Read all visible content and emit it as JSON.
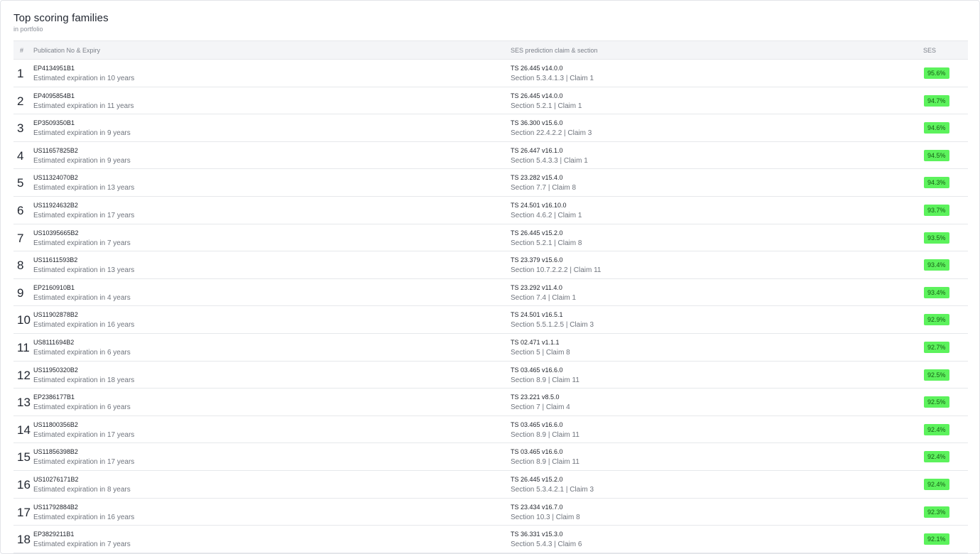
{
  "card": {
    "title": "Top scoring families",
    "subtitle": "in portfolio"
  },
  "table": {
    "headers": {
      "num": "#",
      "pub": "Publication No & Expiry",
      "claim": "SES prediction claim & section",
      "ses": "SES"
    },
    "rows": [
      {
        "num": "1",
        "pub": "EP4134951B1",
        "exp": "Estimated expiration in 10 years",
        "spec": "TS 26.445 v14.0.0",
        "sec": "Section 5.3.4.1.3 | Claim 1",
        "ses": "95.6%"
      },
      {
        "num": "2",
        "pub": "EP4095854B1",
        "exp": "Estimated expiration in 11 years",
        "spec": "TS 26.445 v14.0.0",
        "sec": "Section 5.2.1 | Claim 1",
        "ses": "94.7%"
      },
      {
        "num": "3",
        "pub": "EP3509350B1",
        "exp": "Estimated expiration in 9 years",
        "spec": "TS 36.300 v15.6.0",
        "sec": "Section 22.4.2.2 | Claim 3",
        "ses": "94.6%"
      },
      {
        "num": "4",
        "pub": "US11657825B2",
        "exp": "Estimated expiration in 9 years",
        "spec": "TS 26.447 v16.1.0",
        "sec": "Section 5.4.3.3 | Claim 1",
        "ses": "94.5%"
      },
      {
        "num": "5",
        "pub": "US11324070B2",
        "exp": "Estimated expiration in 13 years",
        "spec": "TS 23.282 v15.4.0",
        "sec": "Section 7.7 | Claim 8",
        "ses": "94.3%"
      },
      {
        "num": "6",
        "pub": "US11924632B2",
        "exp": "Estimated expiration in 17 years",
        "spec": "TS 24.501 v16.10.0",
        "sec": "Section 4.6.2 | Claim 1",
        "ses": "93.7%"
      },
      {
        "num": "7",
        "pub": "US10395665B2",
        "exp": "Estimated expiration in 7 years",
        "spec": "TS 26.445 v15.2.0",
        "sec": "Section 5.2.1 | Claim 8",
        "ses": "93.5%"
      },
      {
        "num": "8",
        "pub": "US11611593B2",
        "exp": "Estimated expiration in 13 years",
        "spec": "TS 23.379 v15.6.0",
        "sec": "Section 10.7.2.2.2 | Claim 11",
        "ses": "93.4%"
      },
      {
        "num": "9",
        "pub": "EP2160910B1",
        "exp": "Estimated expiration in 4 years",
        "spec": "TS 23.292 v11.4.0",
        "sec": "Section 7.4 | Claim 1",
        "ses": "93.4%"
      },
      {
        "num": "10",
        "pub": "US11902878B2",
        "exp": "Estimated expiration in 16 years",
        "spec": "TS 24.501 v16.5.1",
        "sec": "Section 5.5.1.2.5 | Claim 3",
        "ses": "92.9%"
      },
      {
        "num": "11",
        "pub": "US8111694B2",
        "exp": "Estimated expiration in 6 years",
        "spec": "TS 02.471 v1.1.1",
        "sec": "Section 5 | Claim 8",
        "ses": "92.7%"
      },
      {
        "num": "12",
        "pub": "US11950320B2",
        "exp": "Estimated expiration in 18 years",
        "spec": "TS 03.465 v16.6.0",
        "sec": "Section 8.9 | Claim 11",
        "ses": "92.5%"
      },
      {
        "num": "13",
        "pub": "EP2386177B1",
        "exp": "Estimated expiration in 6 years",
        "spec": "TS 23.221 v8.5.0",
        "sec": "Section 7 | Claim 4",
        "ses": "92.5%"
      },
      {
        "num": "14",
        "pub": "US11800356B2",
        "exp": "Estimated expiration in 17 years",
        "spec": "TS 03.465 v16.6.0",
        "sec": "Section 8.9 | Claim 11",
        "ses": "92.4%"
      },
      {
        "num": "15",
        "pub": "US11856398B2",
        "exp": "Estimated expiration in 17 years",
        "spec": "TS 03.465 v16.6.0",
        "sec": "Section 8.9 | Claim 11",
        "ses": "92.4%"
      },
      {
        "num": "16",
        "pub": "US10276171B2",
        "exp": "Estimated expiration in 8 years",
        "spec": "TS 26.445 v15.2.0",
        "sec": "Section 5.3.4.2.1 | Claim 3",
        "ses": "92.4%"
      },
      {
        "num": "17",
        "pub": "US11792884B2",
        "exp": "Estimated expiration in 16 years",
        "spec": "TS 23.434 v16.7.0",
        "sec": "Section 10.3 | Claim 8",
        "ses": "92.3%"
      },
      {
        "num": "18",
        "pub": "EP3829211B1",
        "exp": "Estimated expiration in 7 years",
        "spec": "TS 36.331 v15.3.0",
        "sec": "Section 5.4.3 | Claim 6",
        "ses": "92.1%"
      }
    ]
  },
  "colors": {
    "badge_bg": "#5cf25c",
    "badge_text": "#155d15"
  }
}
